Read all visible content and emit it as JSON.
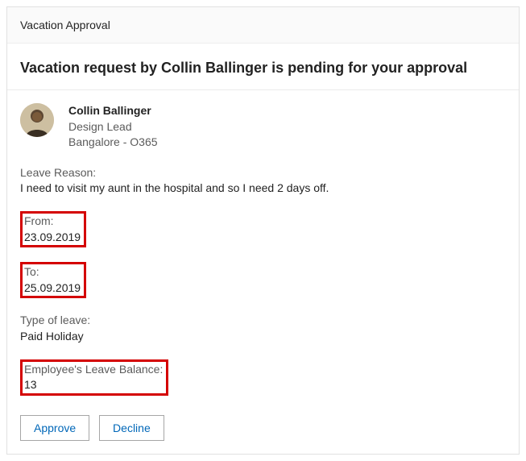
{
  "header": {
    "title": "Vacation Approval"
  },
  "main": {
    "title": "Vacation request by Collin Ballinger is pending for your approval",
    "requester": {
      "name": "Collin Ballinger",
      "role": "Design Lead",
      "location": "Bangalore - O365"
    },
    "reason": {
      "label": "Leave Reason:",
      "value": "I need to visit my aunt in the hospital and so I need 2 days off."
    },
    "from": {
      "label": "From:",
      "value": "23.09.2019"
    },
    "to": {
      "label": "To:",
      "value": "25.09.2019"
    },
    "leave_type": {
      "label": "Type of leave:",
      "value": "Paid Holiday"
    },
    "balance": {
      "label": "Employee's Leave Balance:",
      "value": "13"
    },
    "actions": {
      "approve": "Approve",
      "decline": "Decline"
    }
  }
}
